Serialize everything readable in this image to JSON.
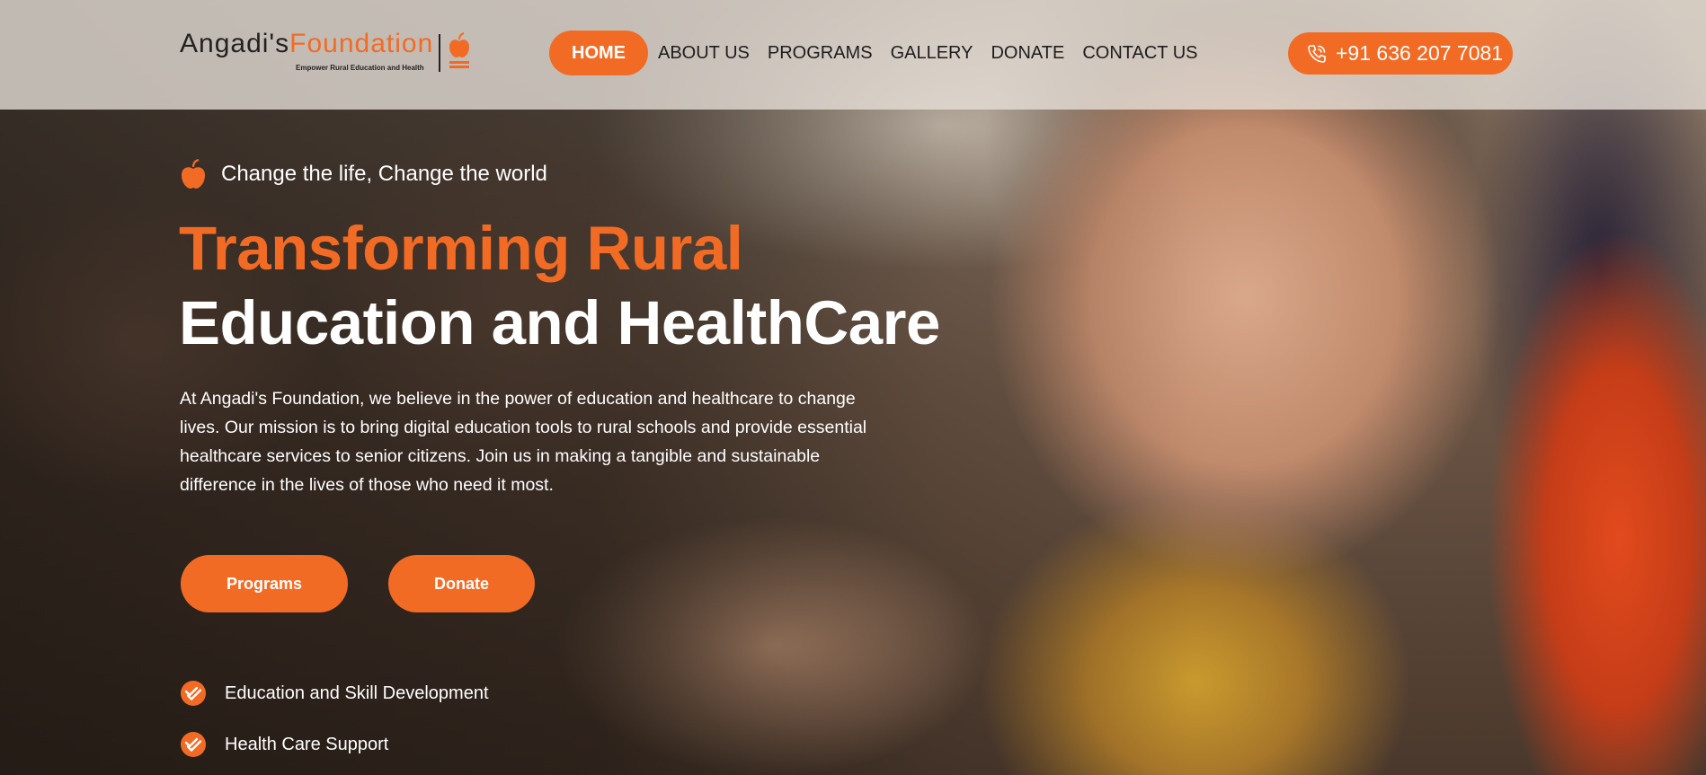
{
  "brand": {
    "name_part1": "Angadi's",
    "name_part2": "Foundation",
    "tagline": "Empower Rural Education and Health",
    "accent_color": "#f26b25"
  },
  "nav": {
    "items": [
      {
        "label": "HOME",
        "active": true
      },
      {
        "label": "ABOUT US",
        "active": false
      },
      {
        "label": "PROGRAMS",
        "active": false
      },
      {
        "label": "GALLERY",
        "active": false
      },
      {
        "label": "DONATE",
        "active": false
      },
      {
        "label": "CONTACT US",
        "active": false
      }
    ]
  },
  "contact": {
    "phone": "+91 636 207 7081",
    "icon": "phone-icon"
  },
  "hero": {
    "tagline": "Change the life, Change the world",
    "tagline_icon": "apple-icon",
    "title_line1": "Transforming Rural",
    "title_line2": "Education and HealthCare",
    "description": "At Angadi's Foundation, we believe in the power of education and healthcare to change lives. Our mission is to bring digital education tools to rural schools and provide essential healthcare services to senior citizens. Join us in making a tangible and sustainable difference in the lives of those who need it most.",
    "buttons": {
      "programs": "Programs",
      "donate": "Donate"
    },
    "features": [
      {
        "label": "Education and Skill Development",
        "icon": "check-badge-icon"
      },
      {
        "label": "Health Care Support",
        "icon": "check-badge-icon"
      }
    ]
  }
}
